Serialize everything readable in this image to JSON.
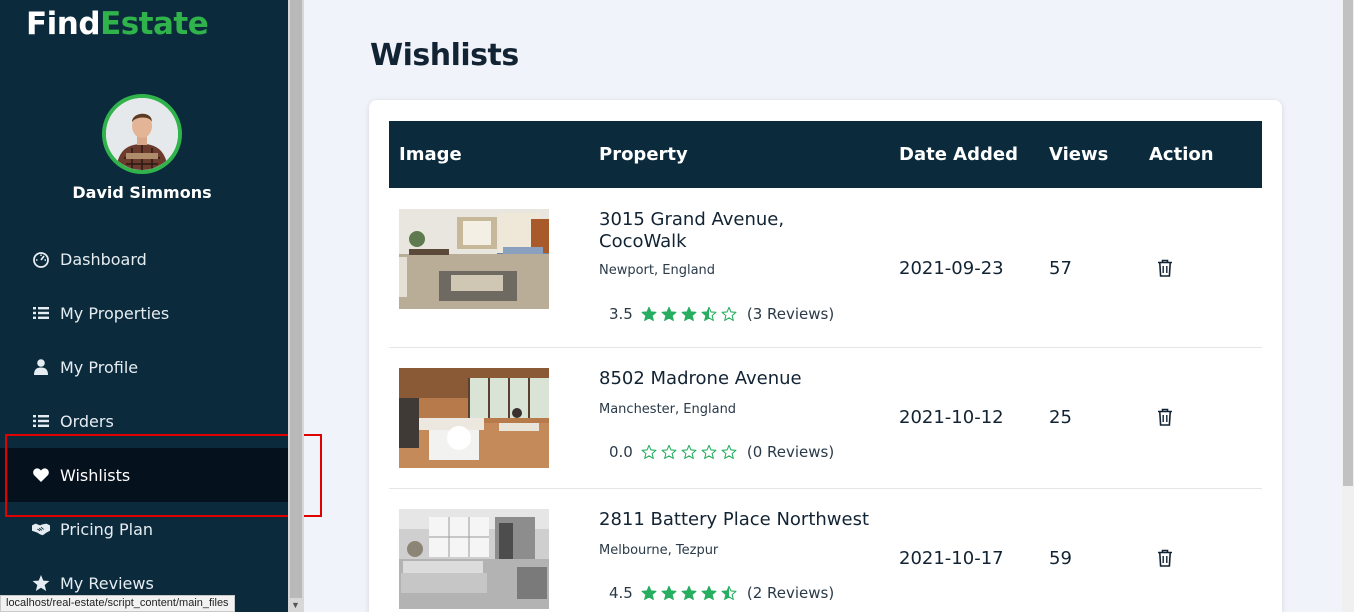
{
  "brand": {
    "part1": "Find",
    "part2": "Estate"
  },
  "user": {
    "name": "David Simmons"
  },
  "sidebar": {
    "items": [
      {
        "label": "Dashboard",
        "icon": "dashboard-icon"
      },
      {
        "label": "My Properties",
        "icon": "list-icon"
      },
      {
        "label": "My Profile",
        "icon": "user-icon"
      },
      {
        "label": "Orders",
        "icon": "list-icon"
      },
      {
        "label": "Wishlists",
        "icon": "heart-icon",
        "active": true
      },
      {
        "label": "Pricing Plan",
        "icon": "handshake-icon"
      },
      {
        "label": "My Reviews",
        "icon": "star-icon"
      }
    ]
  },
  "status_bar": {
    "url": "localhost/real-estate/script_content/main_files"
  },
  "main": {
    "title": "Wishlists",
    "table": {
      "headers": {
        "image": "Image",
        "property": "Property",
        "date": "Date Added",
        "views": "Views",
        "action": "Action"
      },
      "rows": [
        {
          "name": "3015 Grand Avenue, CocoWalk",
          "location": "Newport, England",
          "rating": "3.5",
          "stars": 3.5,
          "reviews": "(3 Reviews)",
          "date": "2021-09-23",
          "views": "57"
        },
        {
          "name": "8502 Madrone Avenue",
          "location": "Manchester, England",
          "rating": "0.0",
          "stars": 0,
          "reviews": "(0 Reviews)",
          "date": "2021-10-12",
          "views": "25"
        },
        {
          "name": "2811 Battery Place Northwest",
          "location": "Melbourne, Tezpur",
          "rating": "4.5",
          "stars": 4.5,
          "reviews": "(2 Reviews)",
          "date": "2021-10-17",
          "views": "59"
        }
      ]
    }
  },
  "colors": {
    "sidebar_bg": "#0b2a3c",
    "accent_green": "#2fb34a",
    "star_green": "#27ae60",
    "active_bg": "#06111e",
    "highlight_red": "#e00000"
  }
}
